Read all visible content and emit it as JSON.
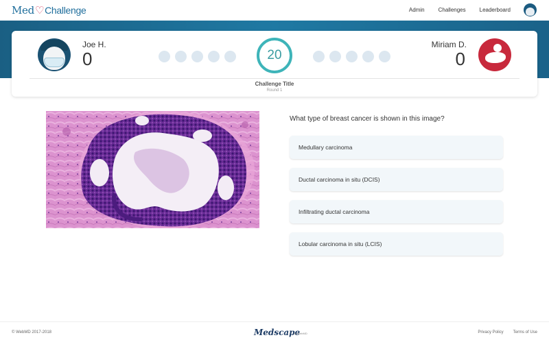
{
  "app": {
    "logo_med": "Med",
    "logo_challenge": "Challenge"
  },
  "nav": {
    "links": [
      "Admin",
      "Challenges",
      "Leaderboard"
    ]
  },
  "players": {
    "left": {
      "name": "Joe H.",
      "score": "0"
    },
    "right": {
      "name": "Miriam D.",
      "score": "0"
    }
  },
  "timer": {
    "value": "20"
  },
  "challenge": {
    "title": "Challenge Title",
    "round": "Round 1"
  },
  "question": {
    "text": "What type of breast cancer is shown in this image?",
    "answers": [
      "Medullary carcinoma",
      "Ductal carcinoma in situ (DCIS)",
      "Infiltrating ductal carcinoma",
      "Lobular carcinoma in situ (LCIS)"
    ]
  },
  "footer": {
    "copyright": "© WebMD 2017-2018",
    "brand": "Medscape",
    "brand_sub": "by WebMD",
    "links": [
      "Privacy Policy",
      "Terms of Use"
    ]
  },
  "colors": {
    "brand_blue": "#1f79a3",
    "timer_teal": "#3eb4b9",
    "answer_bg": "#f2f7fa",
    "heart_red": "#d23a5b"
  }
}
